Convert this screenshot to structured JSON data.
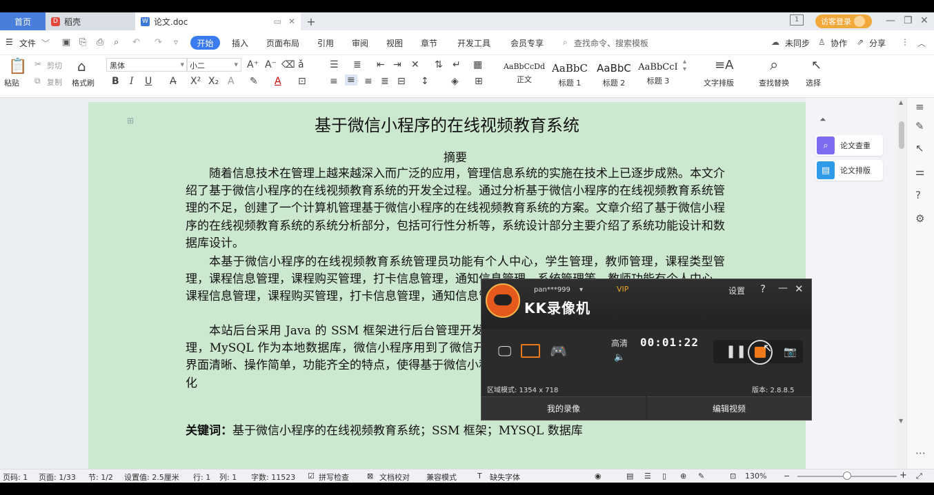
{
  "tabs": {
    "home": "首页",
    "daoke": "稻壳",
    "doc": "论文.doc",
    "add": "+"
  },
  "window": {
    "visitor": "访客登录",
    "page_indicator": "1",
    "minimize": "—",
    "restore": "❐",
    "close": "✕"
  },
  "menu": {
    "file": "文件",
    "start": "开始",
    "items": [
      "插入",
      "页面布局",
      "引用",
      "审阅",
      "视图",
      "章节",
      "开发工具",
      "会员专享"
    ],
    "search": "查找命令、搜索模板",
    "unsync": "未同步",
    "collab": "协作",
    "share": "分享"
  },
  "ribbon": {
    "paste": "粘贴",
    "cut": "剪切",
    "copy": "复制",
    "format_painter": "格式刷",
    "font_name": "黑体",
    "font_size": "小二",
    "styles": [
      {
        "preview": "AaBbCcDd",
        "label": "正文"
      },
      {
        "preview": "AaBbC",
        "label": "标题 1"
      },
      {
        "preview": "AaBbC",
        "label": "标题 2"
      },
      {
        "preview": "AaBbCcI",
        "label": "标题 3"
      }
    ],
    "text_layout": "文字排版",
    "find_replace": "查找替换",
    "select": "选择"
  },
  "document": {
    "title": "基于微信小程序的在线视频教育系统",
    "abstract_heading": "摘要",
    "p1": "随着信息技术在管理上越来越深入而广泛的应用，管理信息系统的实施在技术上已逐步成熟。本文介绍了基于微信小程序的在线视频教育系统的开发全过程。通过分析基于微信小程序的在线视频教育系统管理的不足，创建了一个计算机管理基于微信小程序的在线视频教育系统的方案。文章介绍了基于微信小程序的在线视频教育系统的系统分析部分，包括可行性分析等，系统设计部分主要介绍了系统功能设计和数据库设计。",
    "p2": "本基于微信小程序的在线视频教育系统管理员功能有个人中心，学生管理，教师管理，课程类型管理，课程信息管理，课程购买管理，打卡信息管理，通知信息管理，系统管理等。教师功能有个人中心，课程信息管理，课程购买管理，打卡信息管理，通知信息管理等。用户可以查看课程，购买课程，打",
    "p3": "本站后台采用 Java 的 SSM 框架进行后台管理开发，可以在浏览器上登录进行后台数据方面的管理，MySQL 作为本地数据库，微信小程序用到了微信开发者工具，充分保证系统的稳定性。系统具有界面清晰、操作简单，功能齐全的特点，使得基于微信小程序的在线视频教育系统管理工作系统化、规范化",
    "keywords_label": "关键词：",
    "keywords": "基于微信小程序的在线视频教育系统；SSM 框架；MYSQL 数据库"
  },
  "sidepanel": {
    "check": "论文查重",
    "layout": "论文排版"
  },
  "status": {
    "pages": "页码: 1",
    "page_total": "页面: 1/33",
    "section": "节: 1/2",
    "setting": "设置值: 2.5厘米",
    "line": "行: 1",
    "col": "列: 1",
    "words": "字数: 11523",
    "spell": "拼写检查",
    "proof": "文档校对",
    "compat": "兼容模式",
    "missing_font": "缺失字体",
    "zoom": "130%"
  },
  "recorder": {
    "user": "pan***999",
    "vip": "VIP",
    "settings": "设置",
    "help": "?",
    "minimize": "—",
    "close": "✕",
    "title": "KK录像机",
    "quality": "高清",
    "timer": "00:01:22",
    "region": "区域模式: 1354 x 718",
    "version": "版本: 2.8.8.5",
    "my_recordings": "我的录像",
    "edit_video": "编辑视频"
  },
  "colors": {
    "accent": "#3a7bf0",
    "page_bg": "#cce8cf",
    "recorder_orange": "#f07a1a"
  }
}
